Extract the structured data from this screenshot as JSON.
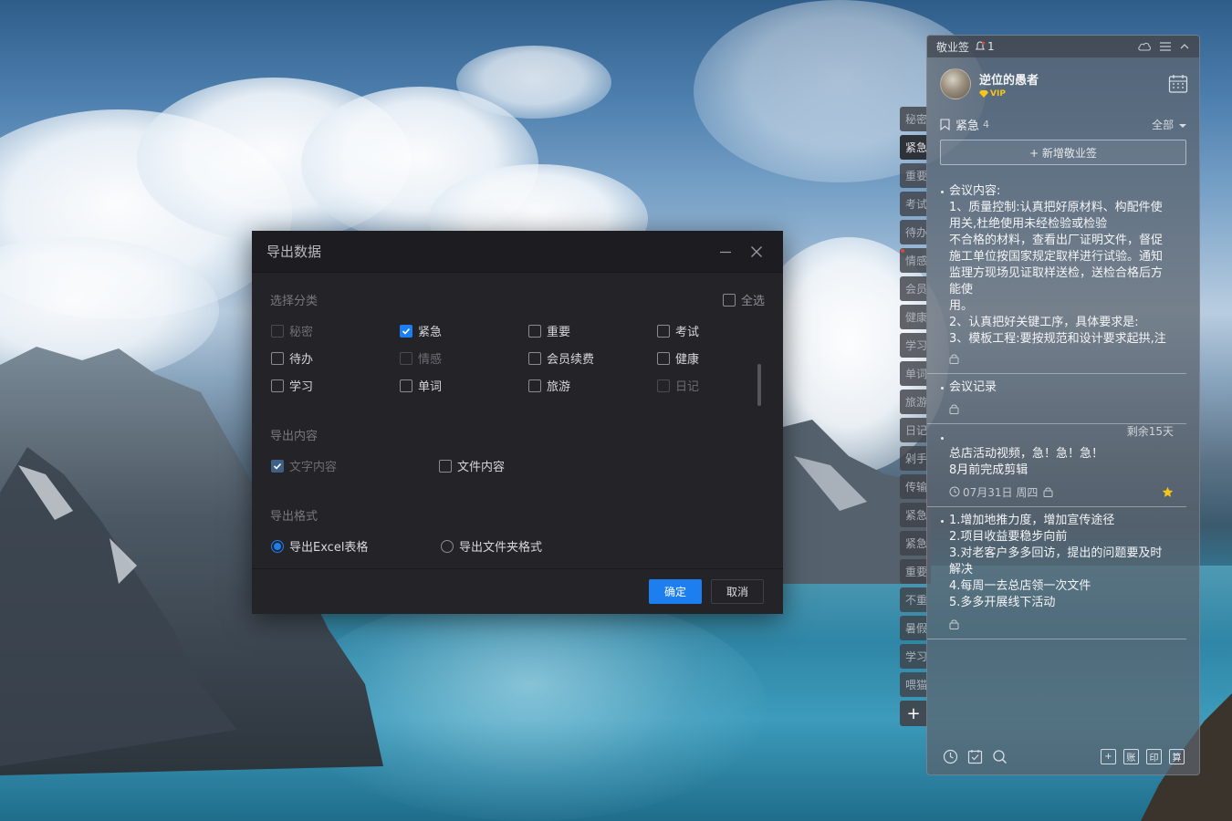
{
  "dialog": {
    "title": "导出数据",
    "sections": {
      "category_label": "选择分类",
      "select_all_label": "全选",
      "content_label": "导出内容",
      "format_label": "导出格式"
    },
    "categories": [
      {
        "label": "秘密",
        "checked": false,
        "disabled": true
      },
      {
        "label": "紧急",
        "checked": true,
        "disabled": false
      },
      {
        "label": "重要",
        "checked": false,
        "disabled": false
      },
      {
        "label": "考试",
        "checked": false,
        "disabled": false
      },
      {
        "label": "待办",
        "checked": false,
        "disabled": false
      },
      {
        "label": "情感",
        "checked": false,
        "disabled": true
      },
      {
        "label": "会员续费",
        "checked": false,
        "disabled": false
      },
      {
        "label": "健康",
        "checked": false,
        "disabled": false
      },
      {
        "label": "学习",
        "checked": false,
        "disabled": false
      },
      {
        "label": "单词",
        "checked": false,
        "disabled": false
      },
      {
        "label": "旅游",
        "checked": false,
        "disabled": false
      },
      {
        "label": "日记",
        "checked": false,
        "disabled": true
      }
    ],
    "content_options": [
      {
        "label": "文字内容",
        "checked": true,
        "disabled": true
      },
      {
        "label": "文件内容",
        "checked": false,
        "disabled": false
      }
    ],
    "format_options": [
      {
        "label": "导出Excel表格",
        "selected": true
      },
      {
        "label": "导出文件夹格式",
        "selected": false
      }
    ],
    "ok_label": "确定",
    "cancel_label": "取消"
  },
  "side_tabs": [
    "秘密",
    "紧急",
    "重要",
    "考试",
    "待办",
    "情感",
    "会员",
    "健康",
    "学习",
    "单词",
    "旅游",
    "日记",
    "剁手",
    "传输",
    "紧急",
    "紧急",
    "重要",
    "不重",
    "暑假",
    "学习",
    "喂猫"
  ],
  "side_tab_active_index": 1,
  "side_tab_dot_index": 5,
  "side_add_label": "+",
  "panel": {
    "app_name": "敬业签",
    "notification_count": "1",
    "user": {
      "name": "逆位的愚者",
      "badge": "VIP"
    },
    "category": {
      "name": "紧急",
      "count": "4",
      "filter": "全部"
    },
    "new_note_label": "+ 新增敬业签",
    "notes": [
      {
        "text": "会议内容:\n1、质量控制:认真把好原材料、构配件使用关,杜绝使用未经检验或检验\n不合格的材料，查看出厂证明文件，督促施工单位按国家规定取样进行试验。通知监理方现场见证取样送检，送检合格后方能使\n用。\n2、认真把好关键工序，具体要求是:\n3、模板工程:要按规范和设计要求起拱,注意标高、轴线位置。先自检签",
        "remain": "",
        "date": "",
        "starred": false
      },
      {
        "text": "会议记录",
        "remain": "",
        "date": "",
        "starred": false
      },
      {
        "text": "总店活动视频，急！急！急！\n8月前完成剪辑",
        "remain": "剩余15天",
        "date": "07月31日 周四",
        "starred": true
      },
      {
        "text": "1.增加地推力度，增加宣传途径\n2.项目收益要稳步向前\n3.对老客户多多回访，提出的问题要及时解决\n4.每周一去总店领一次文件\n5.多多开展线下活动",
        "remain": "",
        "date": "",
        "starred": false
      }
    ],
    "bottom_tools": [
      "账",
      "印",
      "算"
    ]
  },
  "colors": {
    "accent": "#1d7ef0",
    "dialog_bg": "#242428",
    "star": "#f5c518",
    "vip": "#f5c518"
  }
}
